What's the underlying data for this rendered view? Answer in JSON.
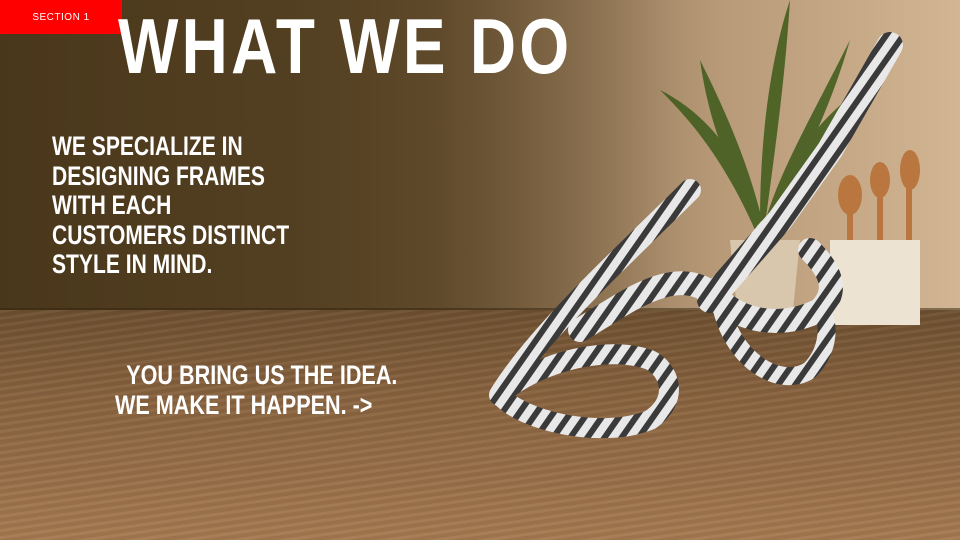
{
  "section_label": "SECTION 1",
  "title": "WHAT WE DO",
  "description_lines": [
    "WE SPECIALIZE IN",
    "DESIGNING FRAMES",
    "WITH EACH",
    "CUSTOMERS DISTINCT",
    "STYLE IN MIND."
  ],
  "cta_lines": [
    "YOU BRING US THE IDEA.",
    "WE MAKE IT HAPPEN. ->"
  ],
  "colors": {
    "section_badge": "#ff0000",
    "text": "#ffffff"
  }
}
